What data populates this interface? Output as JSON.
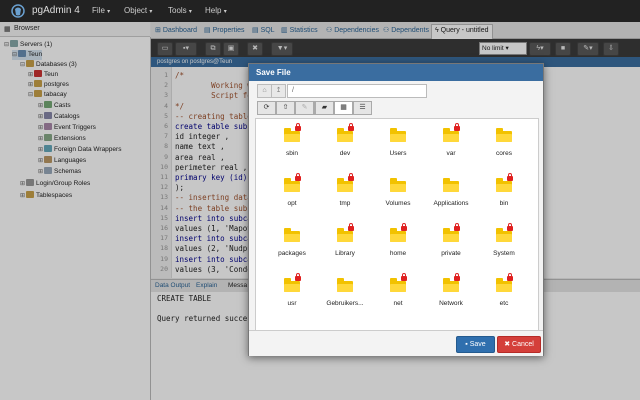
{
  "app": {
    "title": "pgAdmin 4"
  },
  "menu": [
    {
      "label": "File"
    },
    {
      "label": "Object"
    },
    {
      "label": "Tools"
    },
    {
      "label": "Help"
    }
  ],
  "browser": {
    "title": "Browser",
    "tree": [
      {
        "label": "Servers (1)"
      },
      {
        "label": "Teun"
      },
      {
        "label": "Databases (3)"
      },
      {
        "label": "Teun"
      },
      {
        "label": "postgres"
      },
      {
        "label": "tabacay"
      },
      {
        "label": "Casts"
      },
      {
        "label": "Catalogs"
      },
      {
        "label": "Event Triggers"
      },
      {
        "label": "Extensions"
      },
      {
        "label": "Foreign Data Wrappers"
      },
      {
        "label": "Languages"
      },
      {
        "label": "Schemas"
      },
      {
        "label": "Login/Group Roles"
      },
      {
        "label": "Tablespaces"
      }
    ]
  },
  "tabs": [
    {
      "label": "Dashboard"
    },
    {
      "label": "Properties"
    },
    {
      "label": "SQL"
    },
    {
      "label": "Statistics"
    },
    {
      "label": "Dependencies"
    },
    {
      "label": "Dependents"
    },
    {
      "label": "Query - untitled"
    }
  ],
  "query_toolbar": {
    "limit_value": "No limit"
  },
  "connection": {
    "label": "postgres on postgres@Teun"
  },
  "editor": {
    "lines": [
      {
        "n": "1",
        "text": "/*"
      },
      {
        "n": "2",
        "text": "        Working wit"
      },
      {
        "n": "3",
        "text": "        Script fo"
      },
      {
        "n": "4",
        "text": "*/"
      },
      {
        "n": "5",
        "text": "-- creating table"
      },
      {
        "n": "6",
        "text": "create table subc"
      },
      {
        "n": "7",
        "text": "id integer ,"
      },
      {
        "n": "8",
        "text": "name text ,"
      },
      {
        "n": "9",
        "text": "area real ,"
      },
      {
        "n": "10",
        "text": "perimeter real ,"
      },
      {
        "n": "11",
        "text": "primary key (id)"
      },
      {
        "n": "12",
        "text": ");"
      },
      {
        "n": "13",
        "text": "-- inserting data"
      },
      {
        "n": "14",
        "text": "-- the table subc"
      },
      {
        "n": "15",
        "text": "insert into subcat"
      },
      {
        "n": "16",
        "text": "values (1, 'Mapoyo"
      },
      {
        "n": "17",
        "text": "insert into subcat"
      },
      {
        "n": "18",
        "text": "values (2, 'Nudpuc"
      },
      {
        "n": "19",
        "text": "insert into subcat"
      },
      {
        "n": "20",
        "text": "values (3, 'Condor"
      }
    ]
  },
  "output_tabs": [
    {
      "label": "Data Output"
    },
    {
      "label": "Explain"
    },
    {
      "label": "Messa"
    }
  ],
  "output": {
    "line1": "CREATE TABLE",
    "line2": "Query returned successfu"
  },
  "dialog": {
    "title": "Save File",
    "path": "/",
    "files": [
      {
        "name": "sbin",
        "locked": true
      },
      {
        "name": "dev",
        "locked": true
      },
      {
        "name": "Users",
        "locked": false
      },
      {
        "name": "var",
        "locked": true
      },
      {
        "name": "cores",
        "locked": false
      },
      {
        "name": "opt",
        "locked": true
      },
      {
        "name": "tmp",
        "locked": true
      },
      {
        "name": "Volumes",
        "locked": false
      },
      {
        "name": "Applications",
        "locked": false
      },
      {
        "name": "bin",
        "locked": true
      },
      {
        "name": "packages",
        "locked": false
      },
      {
        "name": "Library",
        "locked": true
      },
      {
        "name": "home",
        "locked": true
      },
      {
        "name": "private",
        "locked": true
      },
      {
        "name": "System",
        "locked": true
      },
      {
        "name": "usr",
        "locked": true
      },
      {
        "name": "Gebruikers...",
        "locked": false
      },
      {
        "name": "net",
        "locked": true
      },
      {
        "name": "Network",
        "locked": true
      },
      {
        "name": "etc",
        "locked": true
      }
    ],
    "save_label": "Save",
    "cancel_label": "Cancel"
  }
}
